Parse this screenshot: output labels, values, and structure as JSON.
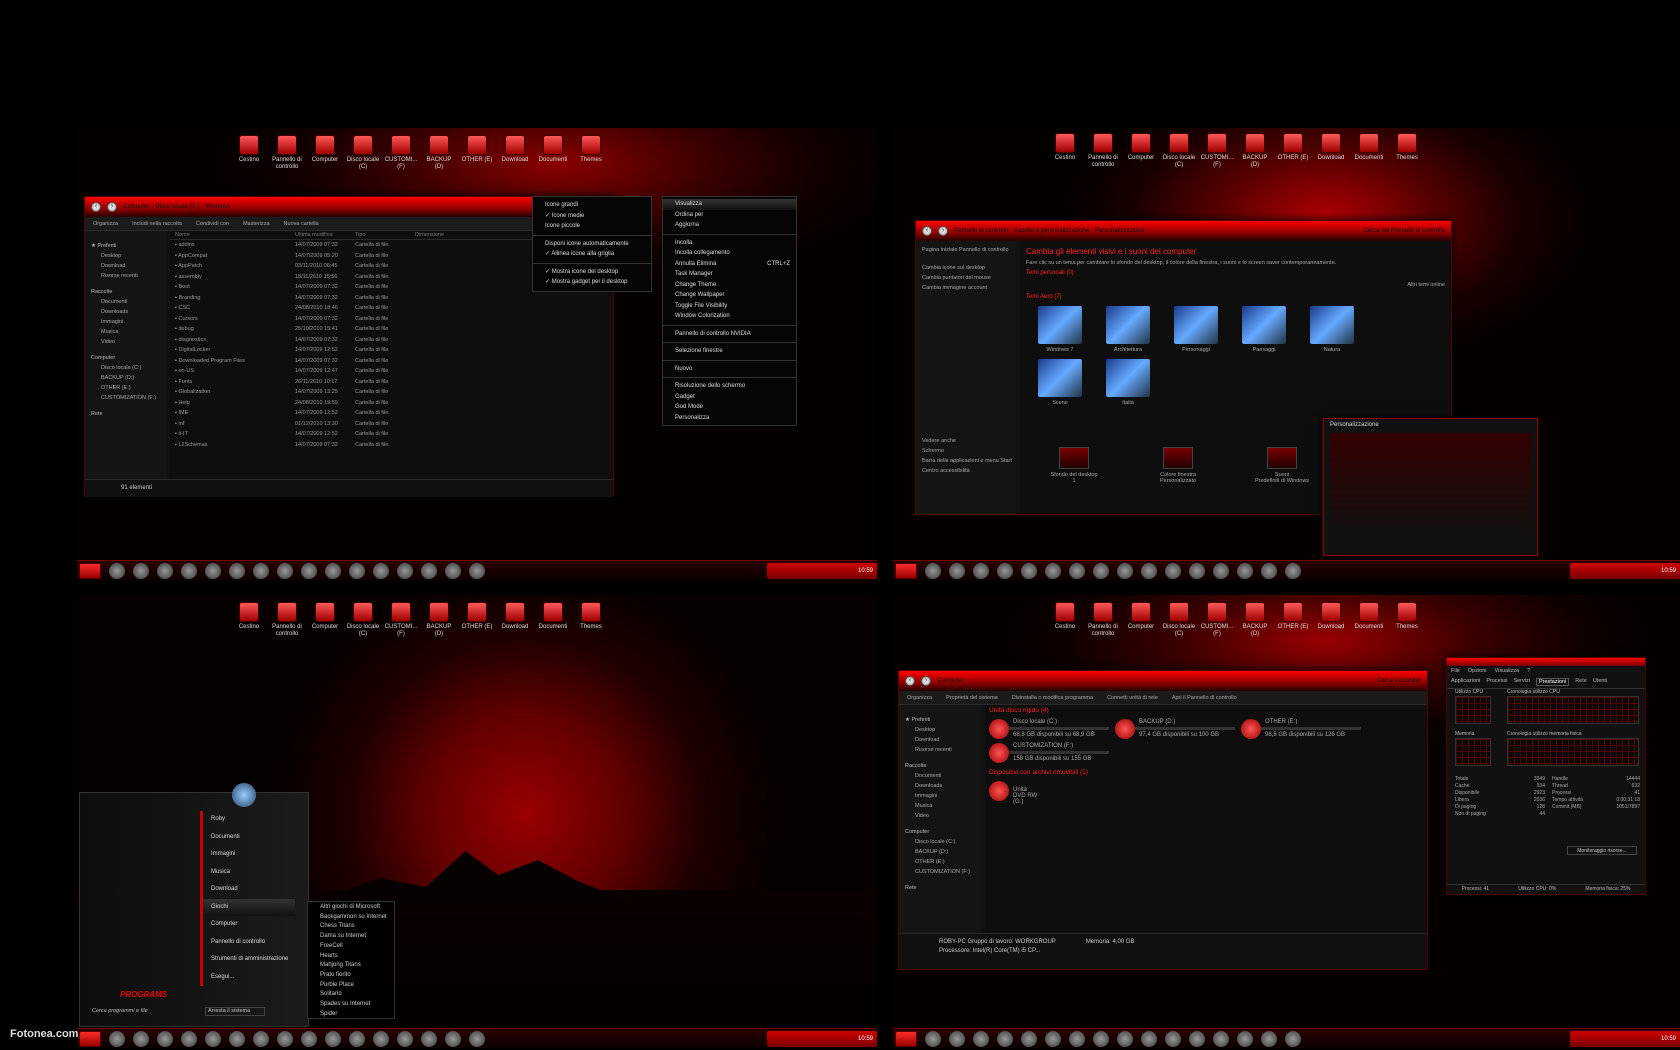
{
  "desktop_icons": [
    "Cestino",
    "Pannello di controllo",
    "Computer",
    "Disco locale (C)",
    "CUSTOMI... (F)",
    "BACKUP (D)",
    "OTHER (E)",
    "Download",
    "Documenti",
    "Themes"
  ],
  "q1": {
    "breadcrumb": [
      "Computer",
      "Disco locale (C:)",
      "Windows"
    ],
    "search": "Cerca Windows",
    "toolbar": [
      "Organizza",
      "Includi nella raccolta",
      "Condividi con",
      "Masterizza",
      "Nuova cartella"
    ],
    "sidebar": {
      "fav": "Preferiti",
      "fav_items": [
        "Desktop",
        "Download",
        "Risorse recenti"
      ],
      "lib": "Raccolte",
      "lib_items": [
        "Documenti",
        "Downloads",
        "Immagini",
        "Musica",
        "Video"
      ],
      "comp": "Computer",
      "comp_items": [
        "Disco locale (C:)",
        "BACKUP (D:)",
        "OTHER (E:)",
        "CUSTOMIZATION (F:)"
      ],
      "net": "Rete"
    },
    "cols": [
      "Nome",
      "Ultima modifica",
      "Tipo",
      "Dimensione"
    ],
    "rows": [
      [
        "addins",
        "14/07/2009 07:32"
      ],
      [
        "AppCompat",
        "14/07/2009 05:20"
      ],
      [
        "AppPatch",
        "03/11/2010 06:45"
      ],
      [
        "assembly",
        "18/11/2010 15:56"
      ],
      [
        "Boot",
        "14/07/2009 07:32"
      ],
      [
        "Branding",
        "14/07/2009 07:32"
      ],
      [
        "CSC",
        "24/08/2010 18:46"
      ],
      [
        "Cursors",
        "14/07/2009 07:32"
      ],
      [
        "debug",
        "25/10/2010 15:41"
      ],
      [
        "diagnostics",
        "14/07/2009 07:32"
      ],
      [
        "DigitalLocker",
        "14/07/2009 12:52"
      ],
      [
        "Downloaded Program Files",
        "14/07/2009 07:32"
      ],
      [
        "en-US",
        "14/07/2009 12:47"
      ],
      [
        "Fonts",
        "26/11/2010 10:17"
      ],
      [
        "Globalization",
        "14/07/2009 13:25"
      ],
      [
        "Help",
        "24/08/2010 19:59"
      ],
      [
        "IME",
        "14/07/2009 12:52"
      ],
      [
        "inf",
        "01/12/2010 13:30"
      ],
      [
        "it-IT",
        "14/07/2009 12:52"
      ],
      [
        "L2Schemas",
        "14/07/2009 07:32"
      ]
    ],
    "type_label": "Cartella di file",
    "status": "91 elementi",
    "view_menu": [
      "Icone grandi",
      "Icone medie",
      "Icone piccole",
      "Disponi icone automaticamente",
      "Allinea icone alla griglia",
      "Mostra icone del desktop",
      "Mostra gadget per il desktop"
    ],
    "ctx_menu": [
      "Visualizza",
      "Ordina per",
      "Aggiorna",
      "Incolla",
      "Incolla collegamento",
      "Annulla Elimina",
      "Task Manager",
      "Change Theme",
      "Change Wallpaper",
      "Toggle File Visibility",
      "Window Colorization",
      "Pannello di controllo NVIDIA",
      "Selezione finestre",
      "Nuovo",
      "Risoluzione dello schermo",
      "Gadget",
      "God Mode",
      "Personalizza"
    ],
    "shortcut": "CTRL+Z"
  },
  "q2": {
    "breadcrumb": [
      "Pannello di controllo",
      "Aspetto e personalizzazione",
      "Personalizzazione"
    ],
    "search": "Cerca nel Pannello di controllo",
    "side": [
      "Pagina iniziale Pannello di controllo",
      "Cambia icone sul desktop",
      "Cambia puntatori del mouse",
      "Cambia immagine account"
    ],
    "side2": [
      "Vedere anche",
      "Schermo",
      "Barra delle applicazioni e menu Start",
      "Centro accessibilità"
    ],
    "heading": "Cambia gli elementi visivi e i suoni del computer",
    "desc": "Fare clic su un tema per cambiare lo sfondo del desktop, il colore della finestra, i suoni e lo screen saver contemporaneamente.",
    "my_themes": "Temi personali (0)",
    "aero": "Temi Aero (7)",
    "online": "Altri temi online",
    "themes": [
      "Windows 7",
      "Architettura",
      "Personaggi",
      "Paesaggi",
      "Natura",
      "Scene",
      "Italia"
    ],
    "bottom": [
      [
        "Sfondo del desktop",
        "1"
      ],
      [
        "Colore finestra",
        "Personalizzato"
      ],
      [
        "Suoni",
        "Predefiniti di Windows"
      ]
    ],
    "preview_title": "Personalizzazione"
  },
  "q3": {
    "start_items": [
      "Roby",
      "Documenti",
      "Immagini",
      "Musica",
      "Download",
      "Giochi",
      "Computer",
      "Pannello di controllo",
      "Strumenti di amministrazione",
      "Esegui..."
    ],
    "programs": "PROGRAMS",
    "search": "Cerca programmi e file",
    "shutdown": "Arresta il sistema",
    "games": [
      "Altri giochi di Microsoft",
      "Backgammon su Internet",
      "Chess Titans",
      "Dama su Internet",
      "FreeCell",
      "Hearts",
      "Mahjong Titans",
      "Prato fiorito",
      "Purble Place",
      "Solitario",
      "Spades su Internet",
      "Spider"
    ]
  },
  "q4": {
    "breadcrumb": [
      "Computer"
    ],
    "search": "Cerca Computer",
    "toolbar": [
      "Organizza",
      "Proprietà del sistema",
      "Disinstalla o modifica programma",
      "Connetti unità di rete",
      "Apri il Pannello di controllo"
    ],
    "hdd": "Unità disco rigido (4)",
    "drives": [
      [
        "Disco locale (C:)",
        "68,8 GB disponibili su 68,9 GB"
      ],
      [
        "BACKUP (D:)",
        "97,4 GB disponibili su 100 GB"
      ],
      [
        "OTHER (E:)",
        "98,8 GB disponibili su 126 GB"
      ],
      [
        "CUSTOMIZATION (F:)",
        "158 GB disponibili su 155 GB"
      ]
    ],
    "removable": "Dispositivi con archivi rimovibili (1)",
    "dvd": "Unità DVD RW (G:)",
    "pc": "ROBY-PC  Gruppo di lavoro: WORKGROUP",
    "mem": "Memoria: 4,00 GB",
    "cpu": "Processore: Intel(R) Core(TM) i5 CP...",
    "tm_tabs": [
      "Applicazioni",
      "Processi",
      "Servizi",
      "Prestazioni",
      "Rete",
      "Utenti"
    ],
    "tm_menu": [
      "File",
      "Opzioni",
      "Visualizza",
      "?"
    ],
    "tm_labels": [
      "Utilizzo CPU",
      "Cronologia utilizzo CPU",
      "Memoria",
      "Cronologia utilizzo memoria fisica"
    ],
    "tm_status": [
      "Processi: 41",
      "Utilizzo CPU: 0%",
      "Memoria fisica: 25%"
    ],
    "tm_stats": [
      [
        "Totale",
        "3949"
      ],
      [
        "Cache",
        "934"
      ],
      [
        "Disponibile",
        "2923"
      ],
      [
        "Libera",
        "2036"
      ]
    ],
    "tm_sys": [
      [
        "Handle",
        "14444"
      ],
      [
        "Thread",
        "632"
      ],
      [
        "Processi",
        "41"
      ],
      [
        "Tempo attività",
        "0:00:31:18"
      ],
      [
        "Commit (MB)",
        "1051/7897"
      ]
    ],
    "tm_kernel": [
      [
        "Di paging",
        "128"
      ],
      [
        "Non di paging",
        "44"
      ]
    ],
    "tm_btn": "Monitoraggio risorse..."
  },
  "tray_time": "10:59",
  "watermark": "Fotonea.com"
}
